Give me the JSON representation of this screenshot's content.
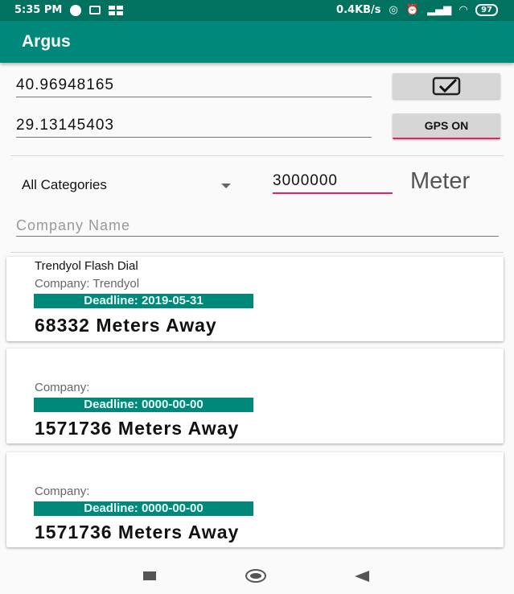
{
  "status_bar": {
    "time": "5:35 PM",
    "net_speed": "0.4KB/s",
    "battery": "97",
    "icons": [
      "whatsapp-icon",
      "android-icon",
      "gallery-icon",
      "hotspot-icon",
      "alarm-icon",
      "signal-icon",
      "wifi-icon",
      "battery-icon"
    ]
  },
  "app_bar": {
    "title": "Argus",
    "color": "#00897b"
  },
  "form": {
    "latitude": "40.96948165",
    "longitude": "29.13145403",
    "checkbox_checked": true,
    "gps_button_label": "GPS ON",
    "category_selected": "All Categories",
    "distance_value": "3000000",
    "distance_unit": "Meter",
    "company_placeholder": "Company Name"
  },
  "results": [
    {
      "title": "Trendyol Flash Dial",
      "company": "Company: Trendyol",
      "deadline": "Deadline: 2019-05-31",
      "distance": "68332 Meters Away"
    },
    {
      "title": "",
      "company": "Company:",
      "deadline": "Deadline: 0000-00-00",
      "distance": "1571736 Meters Away"
    },
    {
      "title": "",
      "company": "Company:",
      "deadline": "Deadline: 0000-00-00",
      "distance": "1571736 Meters Away"
    }
  ],
  "nav_bar": {
    "icons": [
      "recents-icon",
      "home-icon",
      "back-icon"
    ]
  },
  "colors": {
    "accent": "#e91e63",
    "primary": "#00897b",
    "primary_dark": "#00725f"
  }
}
